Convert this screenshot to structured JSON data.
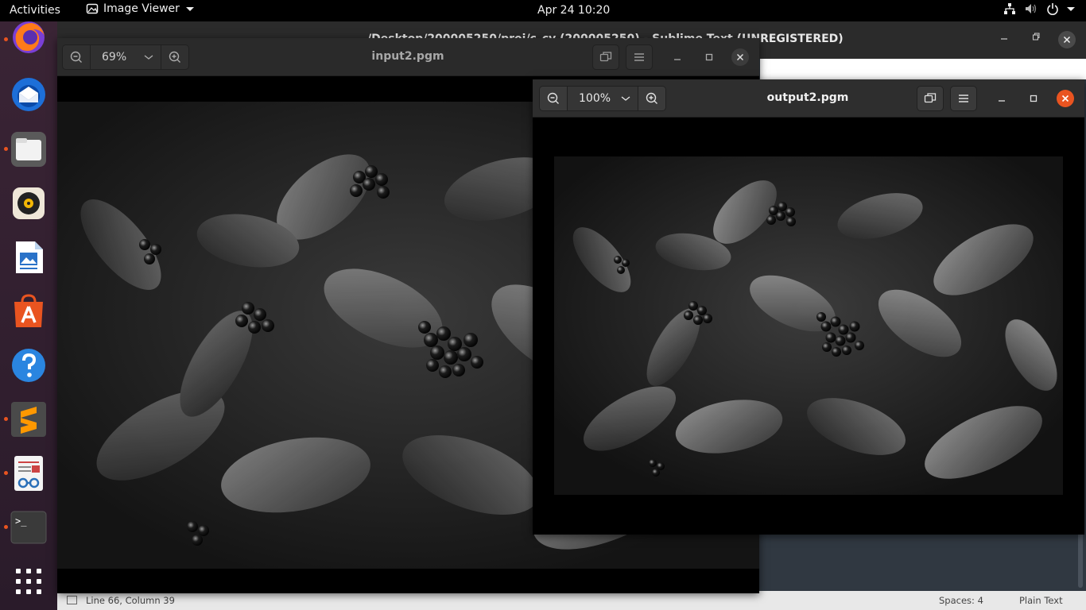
{
  "topbar": {
    "activities": "Activities",
    "app_name": "Image Viewer",
    "clock": "Apr 24  10:20",
    "tray_icons": [
      "network-icon",
      "volume-icon",
      "power-icon",
      "caret-down-icon"
    ]
  },
  "dock": {
    "items": [
      {
        "name": "firefox-icon",
        "running": true
      },
      {
        "name": "thunderbird-icon",
        "running": false
      },
      {
        "name": "files-icon",
        "running": true
      },
      {
        "name": "rhythmbox-icon",
        "running": false
      },
      {
        "name": "libreoffice-writer-icon",
        "running": false
      },
      {
        "name": "ubuntu-software-icon",
        "running": false
      },
      {
        "name": "help-icon",
        "running": false
      },
      {
        "name": "sublime-text-icon",
        "running": true
      },
      {
        "name": "document-viewer-icon",
        "running": true
      },
      {
        "name": "terminal-icon",
        "running": true
      },
      {
        "name": "show-applications-icon",
        "running": false
      }
    ],
    "terminal_prompt": ">_"
  },
  "sublime": {
    "title": "/Desktop/200005250/proj/c_cv (200005250) - Sublime Text (UNREGISTERED)",
    "status_left": "Line 66, Column 39",
    "status_spaces": "Spaces: 4",
    "status_syntax": "Plain Text"
  },
  "viewer_input": {
    "title": "input2.pgm",
    "zoom": "69%"
  },
  "viewer_output": {
    "title": "output2.pgm",
    "zoom": "100%"
  },
  "colors": {
    "accent": "#e95420",
    "topbar": "#000000",
    "headerbar": "#2e2e2e",
    "sublime_editor": "#303841"
  }
}
